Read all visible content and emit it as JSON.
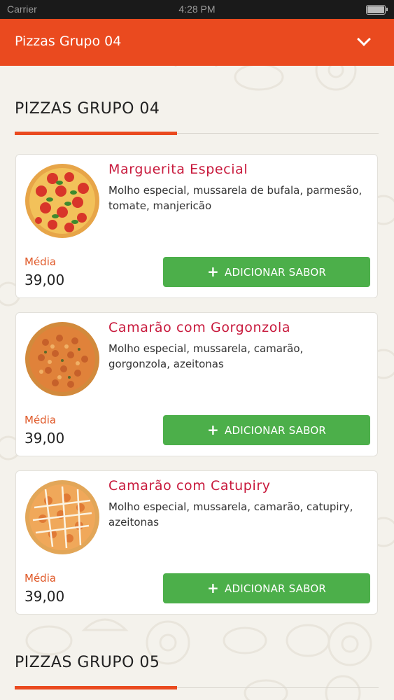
{
  "status_bar": {
    "carrier": "Carrier",
    "time": "4:28 PM"
  },
  "header": {
    "title": "Pizzas Grupo 04",
    "toggle_icon": "chevron-down-icon"
  },
  "sections": [
    {
      "title": "PIZZAS GRUPO 04",
      "items": [
        {
          "name": "Marguerita Especial",
          "description": "Molho especial, mussarela de bufala, parmesão, tomate, manjericão",
          "size_label": "Média",
          "price": "39,00",
          "button_label": "ADICIONAR SABOR",
          "image": "marguerita-pizza-image"
        },
        {
          "name": "Camarão com Gorgonzola",
          "description": "Molho especial, mussarela, camarão, gorgonzola, azeitonas",
          "size_label": "Média",
          "price": "39,00",
          "button_label": "ADICIONAR SABOR",
          "image": "shrimp-gorgonzola-pizza-image"
        },
        {
          "name": "Camarão com Catupiry",
          "description": "Molho especial, mussarela, camarão, catupiry, azeitonas",
          "size_label": "Média",
          "price": "39,00",
          "button_label": "ADICIONAR SABOR",
          "image": "shrimp-catupiry-pizza-image"
        }
      ]
    },
    {
      "title": "PIZZAS GRUPO 05",
      "items": []
    }
  ],
  "colors": {
    "header": "#ea4a1f",
    "accent": "#ea4a1f",
    "product_name": "#c8193c",
    "button": "#4caf4a",
    "background": "#f4f2ec"
  }
}
